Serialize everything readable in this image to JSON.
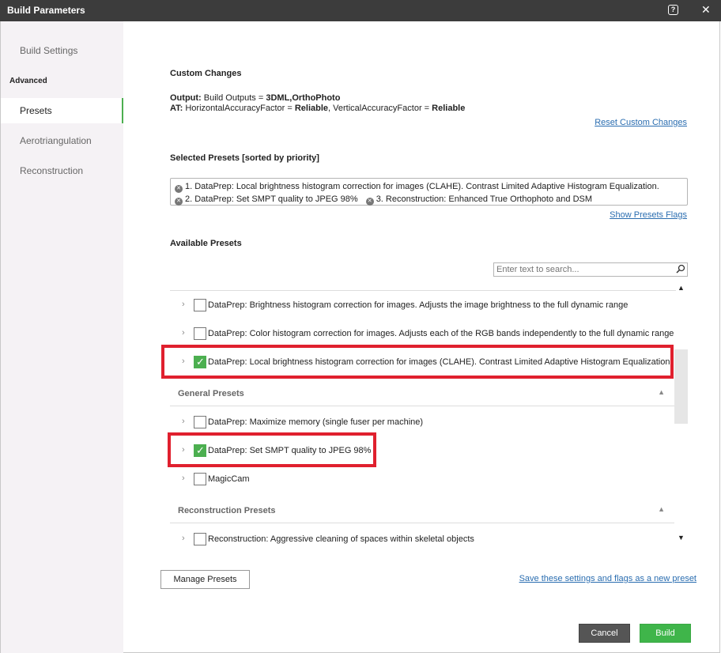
{
  "window": {
    "title": "Build Parameters",
    "help_glyph": "?",
    "close_glyph": "✕"
  },
  "sidebar": {
    "items": [
      {
        "label": "Build Settings"
      },
      {
        "label": "Advanced"
      },
      {
        "label": "Presets",
        "active": true
      },
      {
        "label": "Aerotriangulation"
      },
      {
        "label": "Reconstruction"
      }
    ]
  },
  "custom_changes": {
    "heading": "Custom Changes",
    "output_key": "Output:",
    "output_text": " Build Outputs = ",
    "output_value": "3DML,OrthoPhoto",
    "at_key": "AT:",
    "at_text1": " HorizontalAccuracyFactor = ",
    "at_value1": "Reliable",
    "at_sep": ", VerticalAccuracyFactor = ",
    "at_value2": "Reliable",
    "reset_link": "Reset Custom Changes"
  },
  "selected_presets": {
    "heading": "Selected Presets [sorted by priority]",
    "chips": [
      "1. DataPrep: Local brightness histogram correction for images (CLAHE). Contrast Limited Adaptive Histogram Equalization.",
      "2. DataPrep: Set SMPT quality to JPEG 98%",
      "3. Reconstruction: Enhanced True Orthophoto and DSM"
    ],
    "flags_link": "Show Presets Flags"
  },
  "available_presets": {
    "heading": "Available Presets",
    "search_placeholder": "Enter text to search...",
    "rows": [
      {
        "label": "DataPrep: Brightness histogram correction for images. Adjusts the image brightness to the full dynamic range",
        "checked": false
      },
      {
        "label": "DataPrep: Color histogram correction for images. Adjusts each of the RGB bands independently to the full dynamic range",
        "checked": false
      },
      {
        "label": "DataPrep: Local brightness histogram correction for images (CLAHE). Contrast Limited Adaptive Histogram Equalization.",
        "checked": true
      }
    ],
    "general_header": "General Presets",
    "general_rows": [
      {
        "label": "DataPrep: Maximize memory (single fuser per machine)",
        "checked": false
      },
      {
        "label": "DataPrep: Set SMPT quality to JPEG 98%",
        "checked": true
      },
      {
        "label": "MagicCam",
        "checked": false
      }
    ],
    "reconstruction_header": "Reconstruction Presets",
    "reconstruction_rows": [
      {
        "label": "Reconstruction: Aggressive cleaning of spaces within skeletal objects",
        "checked": false
      }
    ]
  },
  "footer": {
    "manage_button": "Manage Presets",
    "save_link": "Save these settings and flags as a new preset",
    "cancel_button": "Cancel",
    "build_button": "Build"
  },
  "colors": {
    "accent_green": "#4caf50",
    "highlight_red": "#e0202e",
    "link_blue": "#2a6db0",
    "titlebar": "#3c3c3c"
  }
}
